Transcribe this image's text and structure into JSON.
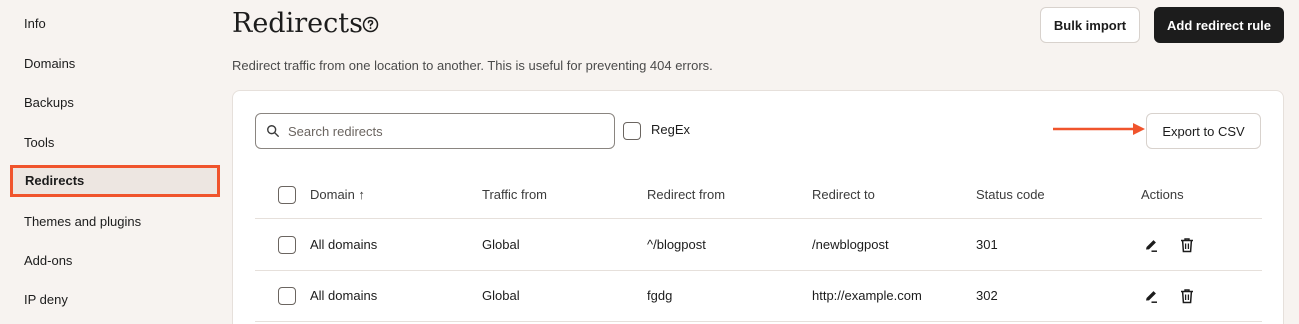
{
  "sidebar": {
    "items": [
      {
        "label": "Info"
      },
      {
        "label": "Domains"
      },
      {
        "label": "Backups"
      },
      {
        "label": "Tools"
      },
      {
        "label": "Redirects",
        "active": true
      },
      {
        "label": "Themes and plugins"
      },
      {
        "label": "Add-ons"
      },
      {
        "label": "IP deny"
      }
    ]
  },
  "header": {
    "title": "Redirects",
    "subtitle": "Redirect traffic from one location to another. This is useful for preventing 404 errors.",
    "bulk_import_label": "Bulk import",
    "add_rule_label": "Add redirect rule"
  },
  "toolbar": {
    "search_placeholder": "Search redirects",
    "regex_label": "RegEx",
    "export_label": "Export to CSV"
  },
  "table": {
    "columns": {
      "domain": "Domain ↑",
      "traffic_from": "Traffic from",
      "redirect_from": "Redirect from",
      "redirect_to": "Redirect to",
      "status_code": "Status code",
      "actions": "Actions"
    },
    "rows": [
      {
        "domain": "All domains",
        "traffic_from": "Global",
        "redirect_from": "^/blogpost",
        "redirect_to": "/newblogpost",
        "status_code": "301"
      },
      {
        "domain": "All domains",
        "traffic_from": "Global",
        "redirect_from": "fgdg",
        "redirect_to": "http://example.com",
        "status_code": "302"
      }
    ]
  },
  "colors": {
    "accent": "#f0542c",
    "primary_button": "#1c1c1c",
    "background": "#f7f3f0"
  }
}
